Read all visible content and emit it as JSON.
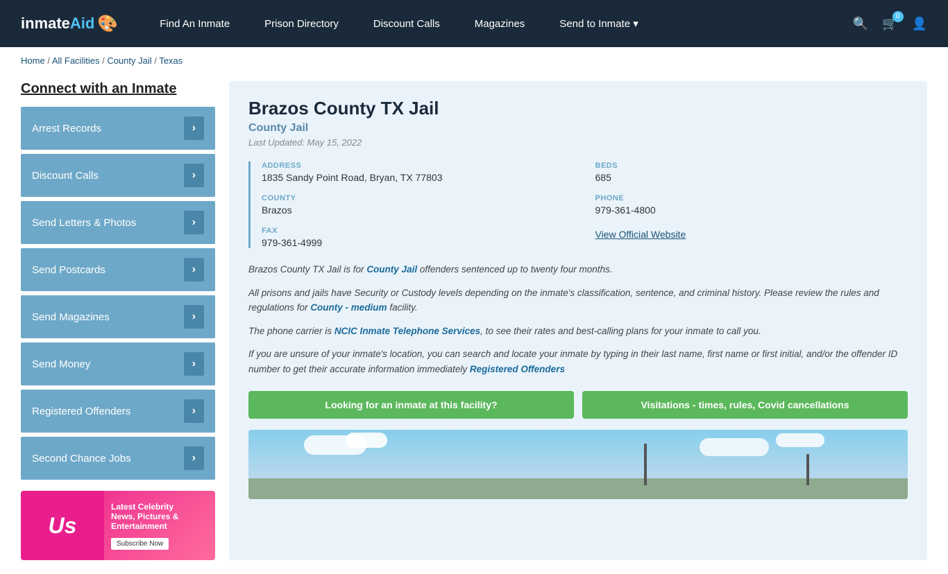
{
  "header": {
    "logo": "inmateAid",
    "logo_icon": "🎨",
    "nav": [
      {
        "label": "Find An Inmate",
        "id": "find-inmate"
      },
      {
        "label": "Prison Directory",
        "id": "prison-directory"
      },
      {
        "label": "Discount Calls",
        "id": "discount-calls"
      },
      {
        "label": "Magazines",
        "id": "magazines"
      },
      {
        "label": "Send to Inmate ▾",
        "id": "send-to-inmate"
      }
    ],
    "cart_count": "0"
  },
  "breadcrumb": {
    "items": [
      "Home",
      "All Facilities",
      "County Jail",
      "Texas"
    ]
  },
  "sidebar": {
    "title": "Connect with an Inmate",
    "menu": [
      {
        "label": "Arrest Records",
        "id": "arrest-records"
      },
      {
        "label": "Discount Calls",
        "id": "discount-calls"
      },
      {
        "label": "Send Letters & Photos",
        "id": "send-letters"
      },
      {
        "label": "Send Postcards",
        "id": "send-postcards"
      },
      {
        "label": "Send Magazines",
        "id": "send-magazines"
      },
      {
        "label": "Send Money",
        "id": "send-money"
      },
      {
        "label": "Registered Offenders",
        "id": "registered-offenders"
      },
      {
        "label": "Second Chance Jobs",
        "id": "second-chance-jobs"
      }
    ],
    "ad": {
      "brand": "Us",
      "headline": "Latest Celebrity\nNews, Pictures &\nEntertainment",
      "cta": "Subscribe Now"
    }
  },
  "facility": {
    "name": "Brazos County TX Jail",
    "type": "County Jail",
    "last_updated": "Last Updated: May 15, 2022",
    "address_label": "ADDRESS",
    "address_value": "1835 Sandy Point Road, Bryan, TX 77803",
    "beds_label": "BEDS",
    "beds_value": "685",
    "county_label": "COUNTY",
    "county_value": "Brazos",
    "phone_label": "PHONE",
    "phone_value": "979-361-4800",
    "fax_label": "FAX",
    "fax_value": "979-361-4999",
    "website_label": "View Official Website",
    "desc1": "Brazos County TX Jail is for County Jail offenders sentenced up to twenty four months.",
    "desc2": "All prisons and jails have Security or Custody levels depending on the inmate's classification, sentence, and criminal history. Please review the rules and regulations for County - medium facility.",
    "desc3": "The phone carrier is NCIC Inmate Telephone Services, to see their rates and best-calling plans for your inmate to call you.",
    "desc4": "If you are unsure of your inmate's location, you can search and locate your inmate by typing in their last name, first name or first initial, and/or the offender ID number to get their accurate information immediately Registered Offenders",
    "btn1": "Looking for an inmate at this facility?",
    "btn2": "Visitations - times, rules, Covid cancellations"
  }
}
